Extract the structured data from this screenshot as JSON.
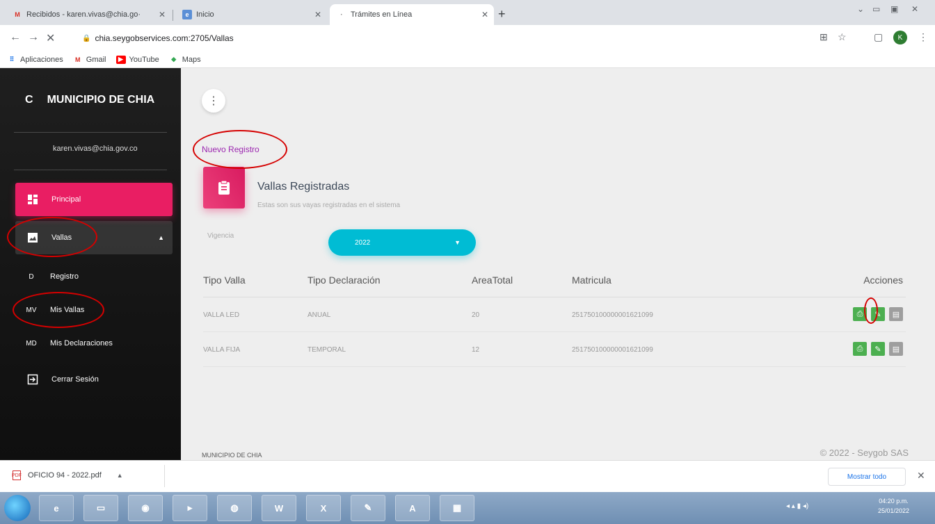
{
  "browser": {
    "tabs": [
      {
        "label": "Recibidos - karen.vivas@chia.go·",
        "active": false
      },
      {
        "label": "Inicio",
        "active": false
      },
      {
        "label": "Trámites en Línea",
        "active": true
      }
    ],
    "new_tab": "+",
    "url": "chia.seygobservices.com:2705/Vallas",
    "bookmarks": [
      "Aplicaciones",
      "Gmail",
      "YouTube",
      "Maps"
    ],
    "profile_initial": "K"
  },
  "sidebar": {
    "brand_short": "C",
    "brand_name": "MUNICIPIO DE CHIA",
    "user_email": "karen.vivas@chia.gov.co",
    "items": [
      {
        "label": "Principal",
        "icon": "dashboard-icon"
      },
      {
        "label": "Vallas",
        "icon": "image-icon"
      },
      {
        "abbr": "D",
        "label": "Registro"
      },
      {
        "abbr": "MV",
        "label": "Mis Vallas"
      },
      {
        "abbr": "MD",
        "label": "Mis Declaraciones"
      },
      {
        "label": "Cerrar Sesión",
        "icon": "logout-icon"
      }
    ]
  },
  "main": {
    "menu_icon": "⋮",
    "nuevo_registro": "Nuevo Registro",
    "card_title": "Vallas Registradas",
    "card_subtitle": "Estas son sus vayas registradas en el sistema",
    "vigencia_label": "Vigencia",
    "vigencia_value": "2022",
    "table": {
      "headers": [
        "Tipo Valla",
        "Tipo Declaración",
        "AreaTotal",
        "Matricula",
        "Acciones"
      ],
      "rows": [
        [
          "VALLA LED",
          "ANUAL",
          "20",
          "251750100000001621099"
        ],
        [
          "VALLA FIJA",
          "TEMPORAL",
          "12",
          "251750100000001621099"
        ]
      ]
    },
    "footer_brand": "MUNICIPIO DE CHIA",
    "footer_copy": "© 2022 - Seygob SAS"
  },
  "downloads": {
    "file": "OFICIO 94 - 2022.pdf",
    "show_all": "Mostrar todo"
  },
  "taskbar": {
    "time": "04:20 p.m.",
    "date": "25/01/2022"
  },
  "colors": {
    "accent_pink": "#e91e63",
    "accent_cyan": "#00bcd4",
    "action_green": "#4caf50",
    "annotation_red": "#d50000"
  }
}
